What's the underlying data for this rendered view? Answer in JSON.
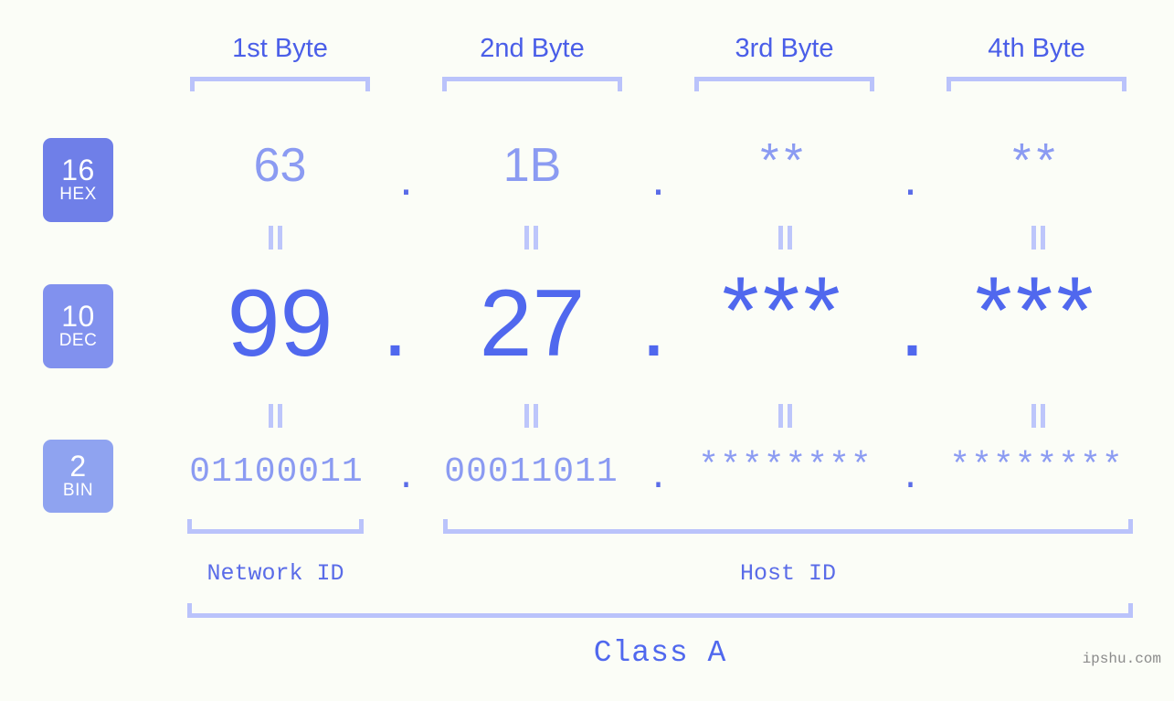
{
  "header": {
    "byte_labels": [
      "1st Byte",
      "2nd Byte",
      "3rd Byte",
      "4th Byte"
    ]
  },
  "bases": [
    {
      "num": "16",
      "name": "HEX",
      "color": "#6f7fe8"
    },
    {
      "num": "10",
      "name": "DEC",
      "color": "#8191ee"
    },
    {
      "num": "2",
      "name": "BIN",
      "color": "#8fa3f0"
    }
  ],
  "rows": {
    "hex": {
      "values": [
        "63",
        "1B",
        "**",
        "**"
      ],
      "separator": "."
    },
    "dec": {
      "values": [
        "99",
        "27",
        "***",
        "***"
      ],
      "separator": "."
    },
    "bin": {
      "values": [
        "01100011",
        "00011011",
        "********",
        "********"
      ],
      "separator": "."
    }
  },
  "equals_symbol": "=",
  "footer": {
    "network_id_label": "Network ID",
    "host_id_label": "Host ID",
    "class_label": "Class A"
  },
  "watermark": "ipshu.com",
  "colors": {
    "background": "#fbfdf7",
    "bracket": "#bac3fb",
    "accent_strong": "#5068ee",
    "accent_light": "#8b9bf2",
    "header_text": "#4a5ee8"
  }
}
